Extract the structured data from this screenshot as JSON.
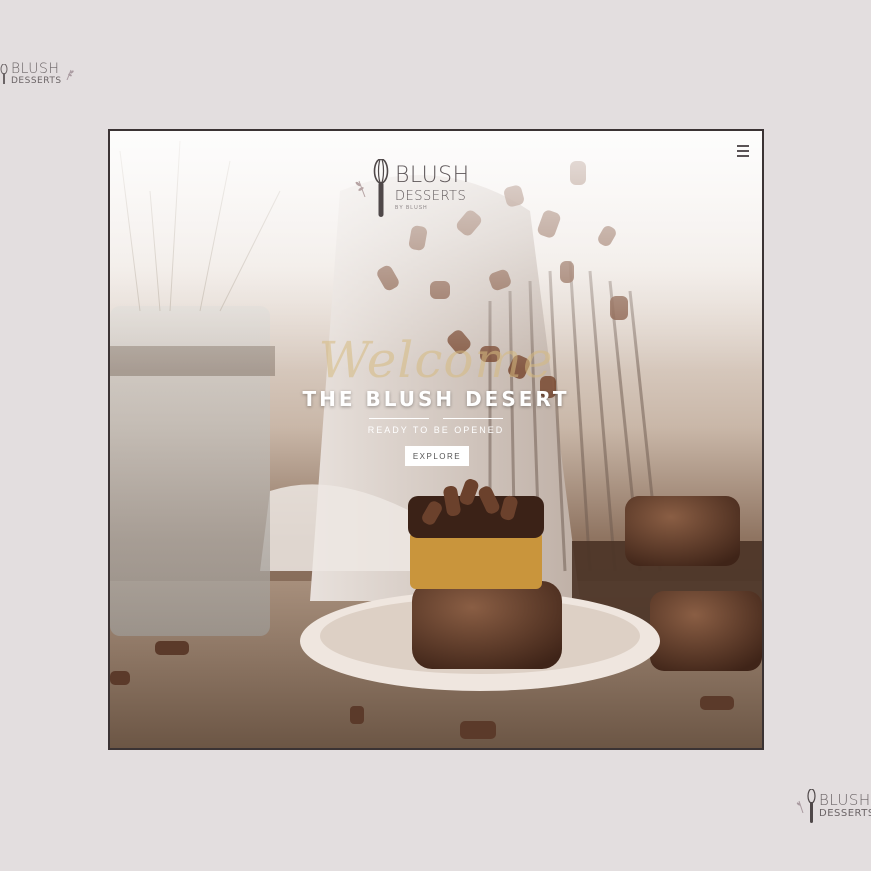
{
  "corner_logo_top": {
    "line1": "BLUSH",
    "line2": "DESSERTS"
  },
  "corner_logo_bottom": {
    "line1": "BLUSH",
    "line2": "DESSERTS"
  },
  "hero": {
    "logo": {
      "line1": "BLUSH",
      "line2": "DESSERTS",
      "line3": "BY BLUSH"
    },
    "script_word": "Welcome",
    "headline": "THE BLUSH DESERT",
    "tagline": "READY TO BE OPENED",
    "explore_label": "EXPLORE",
    "menu_icon": "hamburger-menu-icon"
  },
  "colors": {
    "page_background": "#e3dedf",
    "frame_border": "#3b3334",
    "logo_text": "#5e5759",
    "chocolate": "#5b3a2a"
  }
}
